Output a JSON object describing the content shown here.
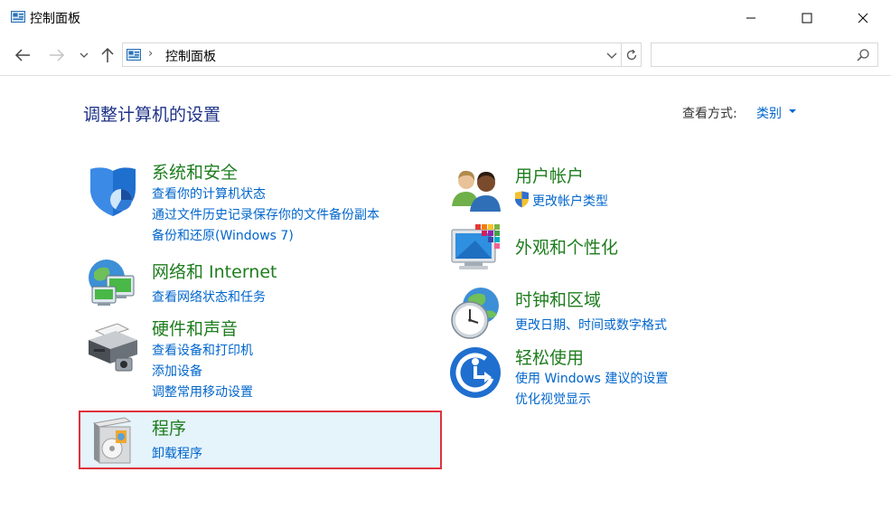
{
  "window": {
    "title": "控制面板"
  },
  "address": {
    "path": "控制面板",
    "separator": "›"
  },
  "search": {
    "placeholder": ""
  },
  "main": {
    "heading": "调整计算机的设置",
    "view_by_label": "查看方式:",
    "view_by_value": "类别"
  },
  "categories": {
    "system": {
      "title": "系统和安全",
      "links": [
        "查看你的计算机状态",
        "通过文件历史记录保存你的文件备份副本",
        "备份和还原(Windows 7)"
      ]
    },
    "network": {
      "title": "网络和 Internet",
      "links": [
        "查看网络状态和任务"
      ]
    },
    "hardware": {
      "title": "硬件和声音",
      "links": [
        "查看设备和打印机",
        "添加设备",
        "调整常用移动设置"
      ]
    },
    "programs": {
      "title": "程序",
      "links": [
        "卸载程序"
      ]
    },
    "users": {
      "title": "用户帐户",
      "links": [
        "更改帐户类型"
      ]
    },
    "appearance": {
      "title": "外观和个性化",
      "links": []
    },
    "clock": {
      "title": "时钟和区域",
      "links": [
        "更改日期、时间或数字格式"
      ]
    },
    "ease": {
      "title": "轻松使用",
      "links": [
        "使用 Windows 建议的设置",
        "优化视觉显示"
      ]
    }
  },
  "colors": {
    "category_title": "#1e7d1e",
    "link": "#0066cc",
    "heading": "#1e3287",
    "highlight_border": "#e0323c",
    "highlight_fill": "#e5f3fb"
  },
  "icons": {
    "app": "control-panel-icon",
    "system": "shield-icon",
    "network": "globe-network-icon",
    "hardware": "printer-icon",
    "programs": "program-disc-icon",
    "users": "users-icon",
    "appearance": "monitor-colors-icon",
    "clock": "clock-globe-icon",
    "ease": "ease-of-access-icon",
    "uac": "uac-shield-icon"
  }
}
